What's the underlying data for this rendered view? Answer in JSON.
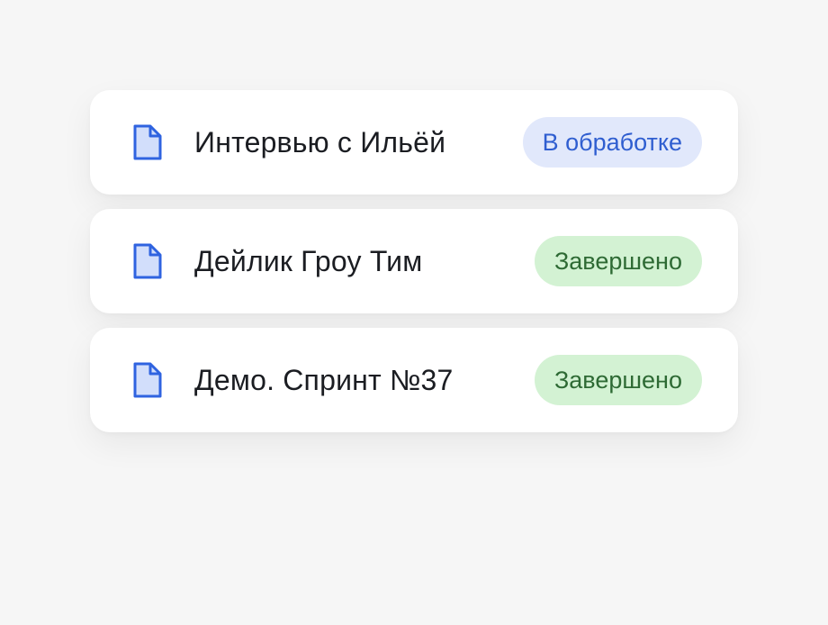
{
  "colors": {
    "background": "#f6f6f6",
    "card": "#ffffff",
    "icon_stroke": "#2f63e0",
    "icon_fill": "#d2defb",
    "processing_bg": "#e1e8fb",
    "processing_text": "#2f5ed0",
    "done_bg": "#d3f2d3",
    "done_text": "#2e6a34"
  },
  "items": [
    {
      "icon": "document-icon",
      "title": "Интервью с Ильёй",
      "status": "В обработке",
      "status_type": "processing"
    },
    {
      "icon": "document-icon",
      "title": "Дейлик Гроу Тим",
      "status": "Завершено",
      "status_type": "done"
    },
    {
      "icon": "document-icon",
      "title": "Демо. Спринт №37",
      "status": "Завершено",
      "status_type": "done"
    }
  ]
}
